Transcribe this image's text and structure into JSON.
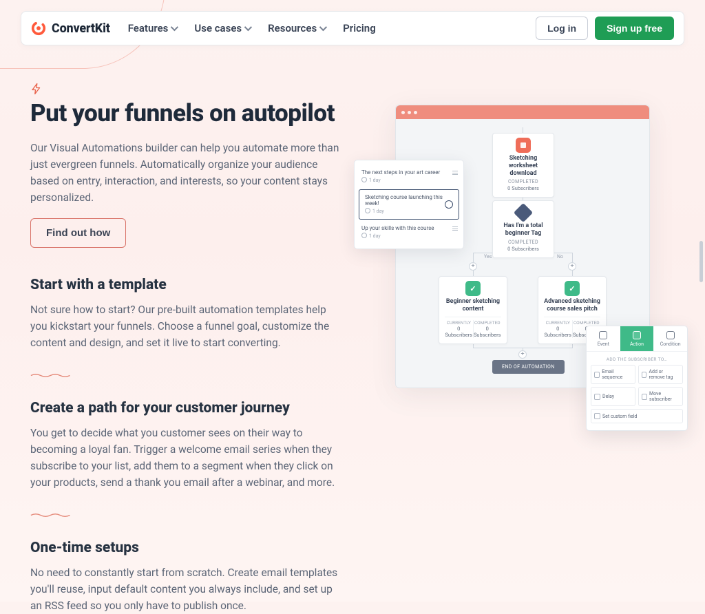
{
  "brand": "ConvertKit",
  "nav": {
    "features": "Features",
    "usecases": "Use cases",
    "resources": "Resources",
    "pricing": "Pricing",
    "login": "Log in",
    "signup": "Sign up free"
  },
  "hero": {
    "title": "Put your funnels on autopilot",
    "body": "Our Visual Automations builder can help you automate more than just evergreen funnels. Automatically organize your audience based on entry, interaction, and interests, so your content stays personalized.",
    "cta": "Find out how"
  },
  "sections": [
    {
      "title": "Start with a template",
      "body": "Not sure how to start? Our pre-built automation templates help you kickstart your funnels. Choose a funnel goal, customize the content and design, and set it live to start converting."
    },
    {
      "title": "Create a path for your customer journey",
      "body": "You get to decide what you customer sees on their way to becoming a loyal fan. Trigger a welcome email series when they subscribe to your list, add them to a segment when they click on your products, send a thank you email after a webinar, and more."
    },
    {
      "title": "One-time setups",
      "body": "No need to constantly start from scratch. Create email templates you'll reuse, input default content you always include, and set up an RSS feed so you only have to publish once."
    }
  ],
  "mock": {
    "entry_title": "Sketching worksheet download",
    "entry_status": "COMPLETED",
    "entry_sub": "0 Subscribers",
    "cond_title": "Has I'm a total beginner Tag",
    "cond_status": "COMPLETED",
    "cond_sub": "0 Subscribers",
    "yes": "Yes",
    "no": "No",
    "leftcard_title": "Beginner sketching content",
    "rightcard_title": "Advanced sketching course sales pitch",
    "split_lbl": "CURRENTLY",
    "split_val": "0 Subscribers",
    "end": "END OF AUTOMATION",
    "steps": {
      "s1": "The next steps in your art career",
      "s2": "Sketching course launching this week!",
      "s3": "Up your skills with this course",
      "delay": "1 day"
    },
    "picker": {
      "t_event": "Event",
      "t_action": "Action",
      "t_condition": "Condition",
      "head": "ADD THE SUBSCRIBER TO…",
      "email_sequence": "Email sequence",
      "add_remove_tag": "Add or remove tag",
      "delay": "Delay",
      "move_subscriber": "Move subscriber",
      "set_custom_field": "Set custom field"
    }
  }
}
